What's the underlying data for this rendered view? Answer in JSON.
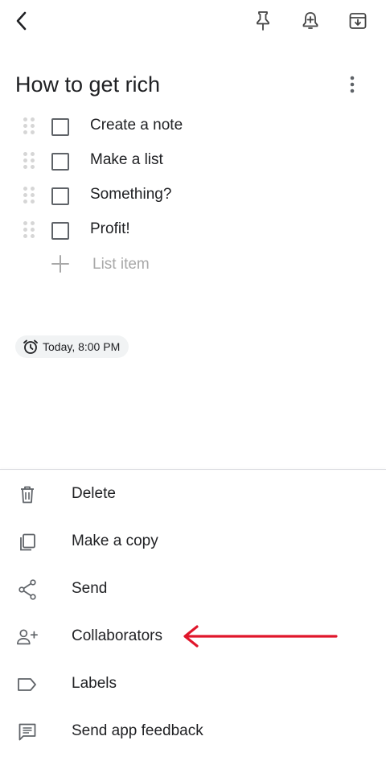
{
  "toolbar": {
    "back_icon": "back-arrow-icon",
    "pin_icon": "pin-icon",
    "reminder_icon": "add-reminder-bell-icon",
    "archive_icon": "archive-icon"
  },
  "note": {
    "title": "How to get rich",
    "more_icon": "more-vertical-icon",
    "items": [
      {
        "label": "Create a note",
        "checked": false
      },
      {
        "label": "Make a list",
        "checked": false
      },
      {
        "label": "Something?",
        "checked": false
      },
      {
        "label": "Profit!",
        "checked": false
      }
    ],
    "add_item_placeholder": "List item",
    "reminder_chip": "Today, 8:00 PM"
  },
  "menu": {
    "items": [
      {
        "label": "Delete",
        "icon": "trash-icon"
      },
      {
        "label": "Make a copy",
        "icon": "copy-icon"
      },
      {
        "label": "Send",
        "icon": "share-icon"
      },
      {
        "label": "Collaborators",
        "icon": "add-person-icon"
      },
      {
        "label": "Labels",
        "icon": "label-icon"
      },
      {
        "label": "Send app feedback",
        "icon": "feedback-icon"
      }
    ]
  },
  "annotation": {
    "color": "#e0162b",
    "points_to": "Collaborators"
  }
}
